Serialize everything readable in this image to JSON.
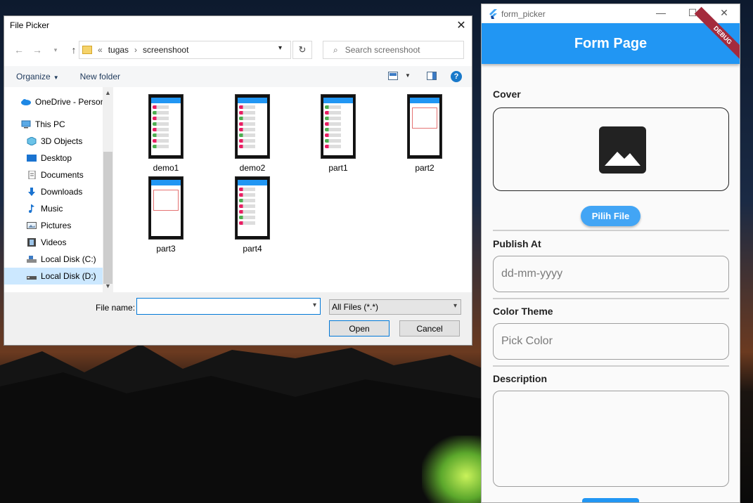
{
  "file_picker": {
    "title": "File Picker",
    "breadcrumb": [
      "«",
      "tugas",
      "›",
      "screenshoot"
    ],
    "search_placeholder": "Search screenshoot",
    "organize_label": "Organize",
    "new_folder_label": "New folder",
    "help_label": "?",
    "nav_items": [
      {
        "label": "OneDrive - Person",
        "icon": "onedrive-icon"
      },
      {
        "label": "This PC",
        "icon": "computer-icon"
      },
      {
        "label": "3D Objects",
        "icon": "cube-icon"
      },
      {
        "label": "Desktop",
        "icon": "desktop-icon"
      },
      {
        "label": "Documents",
        "icon": "document-icon"
      },
      {
        "label": "Downloads",
        "icon": "download-icon"
      },
      {
        "label": "Music",
        "icon": "music-icon"
      },
      {
        "label": "Pictures",
        "icon": "pictures-icon"
      },
      {
        "label": "Videos",
        "icon": "video-icon"
      },
      {
        "label": "Local Disk (C:)",
        "icon": "drive-icon"
      },
      {
        "label": "Local Disk (D:)",
        "icon": "drive-icon",
        "selected": true
      }
    ],
    "files": [
      "demo1",
      "demo2",
      "part1",
      "part2",
      "part3",
      "part4"
    ],
    "filename_label": "File name:",
    "filename_value": "",
    "filetype_value": "All Files (*.*)",
    "open_label": "Open",
    "cancel_label": "Cancel"
  },
  "app": {
    "window_title": "form_picker",
    "page_title": "Form Page",
    "debug_banner": "DEBUG",
    "cover_label": "Cover",
    "pick_file_label": "Pilih File",
    "publish_label": "Publish At",
    "publish_placeholder": "dd-mm-yyyy",
    "color_label": "Color Theme",
    "color_placeholder": "Pick Color",
    "description_label": "Description",
    "accent_color": "#2196f3"
  }
}
